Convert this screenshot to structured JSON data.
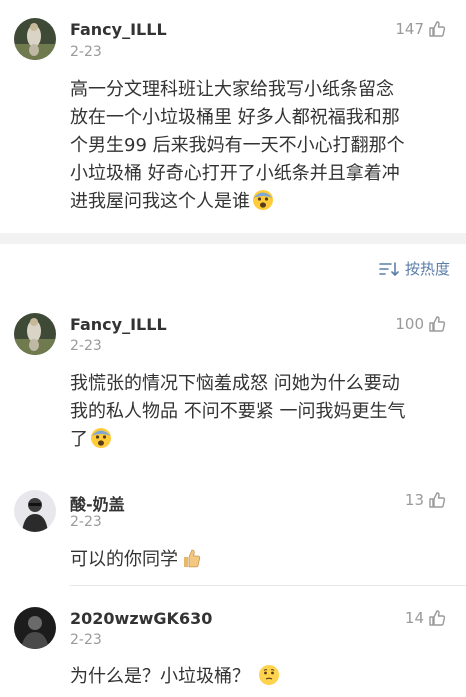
{
  "top_comment": {
    "username": "Fancy_ILLL",
    "date": "2-23",
    "likes": "147",
    "lines": [
      "高一分文理科班让大家给我写小纸条留念",
      "放在一个小垃圾桶里 好多人都祝福我和那",
      "个男生99 后来我妈有一天不小心打翻那个",
      "小垃圾桶 好奇心打开了小纸条并且拿着冲",
      "进我屋问我这个人是谁"
    ],
    "emoji": "fearful-face-emoji"
  },
  "sort": {
    "label": "按热度",
    "icon": "sort-icon"
  },
  "replies": [
    {
      "username": "Fancy_ILLL",
      "date": "2-23",
      "likes": "100",
      "lines": [
        "我慌张的情况下恼羞成怒 问她为什么要动",
        "我的私人物品 不问不要紧 一问我妈更生气",
        "了"
      ],
      "emoji": "fearful-face-emoji"
    },
    {
      "username": "酸-奶盖",
      "date": "2-23",
      "likes": "13",
      "lines": [
        "可以的你同学"
      ],
      "emoji": "thumbs-up-emoji"
    },
    {
      "username": "2020wzwGK630",
      "date": "2-23",
      "likes": "14",
      "lines": [
        "为什么是？小垃圾桶？"
      ],
      "emoji": "thinking-face-emoji"
    }
  ],
  "colors": {
    "accent_blue": "#5b7ea8",
    "meta_gray": "#9a9a9a",
    "text": "#333333",
    "section_bg": "#f2f2f2"
  }
}
